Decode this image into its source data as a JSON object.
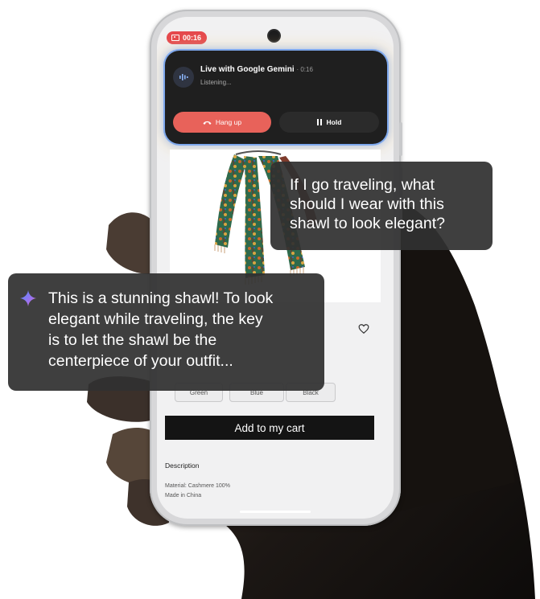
{
  "status_bar": {
    "timer": "00:16"
  },
  "call": {
    "title": "Live with Google Gemini",
    "time": "· 0:16",
    "status": "Listening...",
    "hangup_label": "Hang up",
    "hold_label": "Hold",
    "colors": {
      "hangup": "#e8625a",
      "hold": "#2b2b2b",
      "card": "#1f1f1f"
    }
  },
  "product": {
    "image": "paisley-shawl",
    "swatches": [
      "Green",
      "Blue",
      "Black"
    ],
    "cart_label": "Add to my cart",
    "description_title": "Description",
    "description_lines": [
      "Material: Cashmere 100%",
      "Made in China"
    ]
  },
  "user_bubble": {
    "lines": [
      "If I go traveling, what",
      "should I wear with this",
      "shawl to look elegant?"
    ]
  },
  "ai_bubble": {
    "lines": [
      "This is a stunning shawl! To look",
      "elegant while traveling, the key",
      "is to let the shawl be the",
      "centerpiece of your outfit..."
    ]
  },
  "icons": {
    "sparkle": "gemini-sparkle-icon",
    "heart": "heart-icon",
    "phone": "phone-hangup-icon",
    "pause": "pause-icon"
  }
}
